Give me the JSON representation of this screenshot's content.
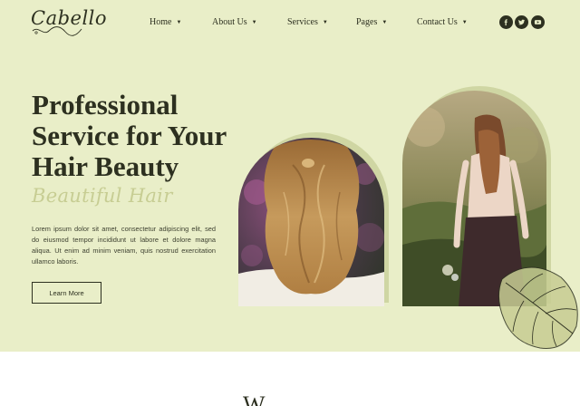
{
  "logo": {
    "text": "Cabello"
  },
  "nav": {
    "items": [
      {
        "label": "Home"
      },
      {
        "label": "About Us"
      },
      {
        "label": "Services"
      },
      {
        "label": "Pages"
      },
      {
        "label": "Contact Us"
      }
    ]
  },
  "social": [
    {
      "icon": "facebook-icon",
      "glyph": "f"
    },
    {
      "icon": "twitter-icon",
      "glyph": "t"
    },
    {
      "icon": "youtube-icon",
      "glyph": "▶"
    }
  ],
  "hero": {
    "headline": "Professional Service for Your Hair Beauty",
    "script_title": "Beautiful Hair",
    "body": "Lorem ipsum dolor sit amet, consectetur adipiscing elit, sed do eiusmod tempor incididunt ut labore et dolore magna aliqua. Ut enim ad minim veniam, quis nostrud exercitation ullamco laboris.",
    "button_label": "Learn More"
  },
  "welcome": {
    "heading_partial": "W"
  },
  "colors": {
    "hero_bg": "#e9eec8",
    "accent_script": "#c7cd93",
    "arch_back": "#cfd6a3",
    "text_dark": "#2d3020"
  }
}
